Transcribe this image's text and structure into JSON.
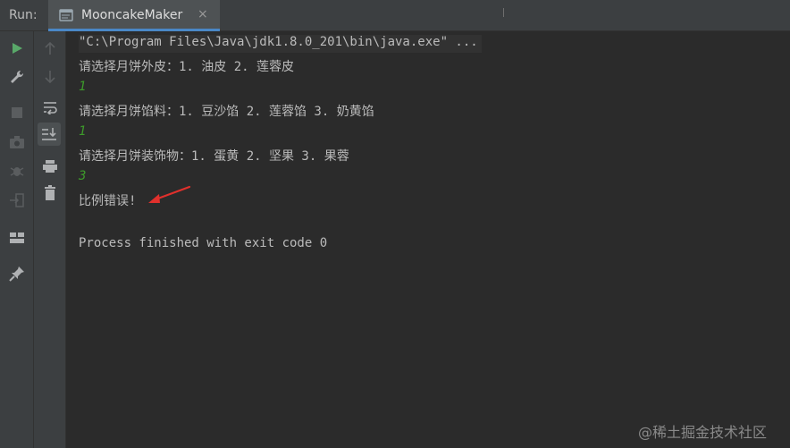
{
  "header": {
    "run_label": "Run:",
    "tab_title": "MooncakeMaker",
    "tab_close": "×"
  },
  "toolbar_left": [
    "run-icon",
    "wrench-icon",
    "stop-icon",
    "camera-icon",
    "bug-icon",
    "exit-icon",
    "layout-icon",
    "pin-icon"
  ],
  "toolbar_right": [
    "up-arrow-icon",
    "down-arrow-icon",
    "soft-wrap-icon",
    "scroll-to-end-icon",
    "print-icon",
    "trash-icon"
  ],
  "console": {
    "lines": [
      {
        "type": "cmd",
        "text": "\"C:\\Program Files\\Java\\jdk1.8.0_201\\bin\\java.exe\" ..."
      },
      {
        "type": "out",
        "text": "请选择月饼外皮：1. 油皮 2. 莲蓉皮"
      },
      {
        "type": "input",
        "text": "1"
      },
      {
        "type": "out",
        "text": "请选择月饼馅料：1. 豆沙馅 2. 莲蓉馅 3. 奶黄馅"
      },
      {
        "type": "input",
        "text": "1"
      },
      {
        "type": "out",
        "text": "请选择月饼装饰物：1. 蛋黄 2. 坚果 3. 果蓉"
      },
      {
        "type": "input",
        "text": "3"
      },
      {
        "type": "out",
        "text": "比例错误!"
      },
      {
        "type": "blank",
        "text": ""
      },
      {
        "type": "out",
        "text": "Process finished with exit code 0"
      }
    ]
  },
  "watermark": "@稀土掘金技术社区",
  "colors": {
    "accent": "#4a88c7",
    "input_green": "#3d9a2b",
    "run_green": "#59a869",
    "annotation_red": "#e0302c"
  }
}
